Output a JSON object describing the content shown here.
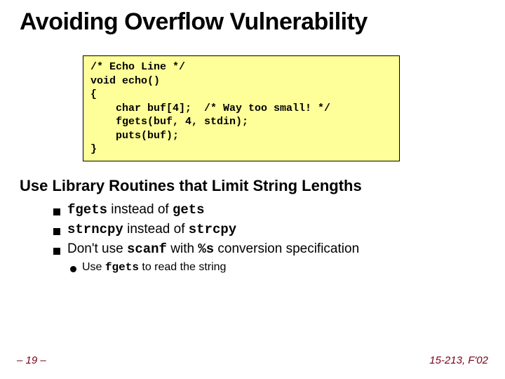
{
  "title": "Avoiding Overflow Vulnerability",
  "code": "/* Echo Line */\nvoid echo()\n{\n    char buf[4];  /* Way too small! */\n    fgets(buf, 4, stdin);\n    puts(buf);\n}",
  "subhead": "Use Library Routines that Limit String Lengths",
  "bullets": {
    "b1a_pre": "fgets",
    "b1a_mid": " instead of ",
    "b1a_post": "gets",
    "b1b_pre": "strncpy",
    "b1b_mid": " instead of ",
    "b1b_post": "strcpy",
    "b1c_pre": "Don't use ",
    "b1c_m1": "scanf",
    "b1c_mid": " with ",
    "b1c_m2": "%s",
    "b1c_post": " conversion specification",
    "b2_pre": "Use ",
    "b2_m": "fgets",
    "b2_post": " to read the string"
  },
  "footer": {
    "left": "– 19 –",
    "right": "15-213, F'02"
  }
}
